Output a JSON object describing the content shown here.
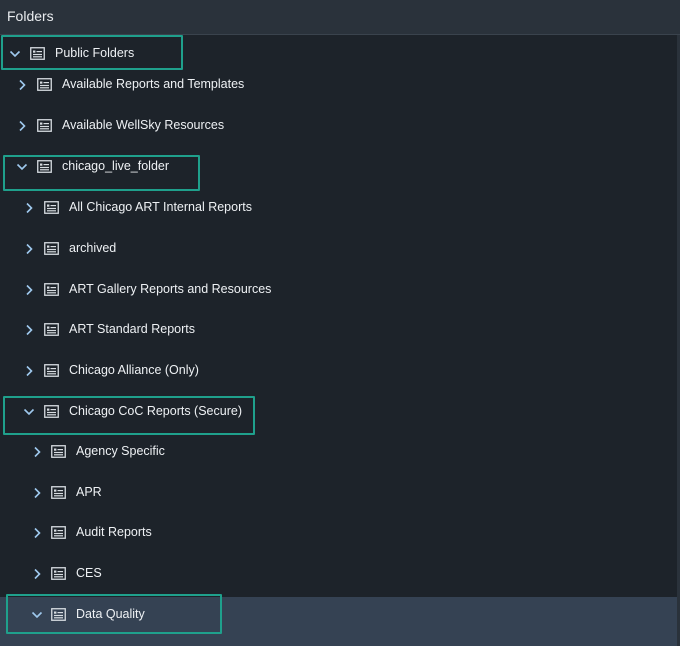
{
  "header": {
    "title": "Folders"
  },
  "tree": {
    "items": [
      {
        "label": "Public Folders",
        "expanded": true,
        "level": 0
      },
      {
        "label": "Available Reports and Templates",
        "expanded": false,
        "level": 1
      },
      {
        "label": "Available WellSky Resources",
        "expanded": false,
        "level": 1
      },
      {
        "label": "chicago_live_folder",
        "expanded": true,
        "level": 1
      },
      {
        "label": "All Chicago ART Internal Reports",
        "expanded": false,
        "level": 2
      },
      {
        "label": "archived",
        "expanded": false,
        "level": 2
      },
      {
        "label": "ART Gallery Reports and Resources",
        "expanded": false,
        "level": 2
      },
      {
        "label": "ART Standard Reports",
        "expanded": false,
        "level": 2
      },
      {
        "label": "Chicago Alliance (Only)",
        "expanded": false,
        "level": 2
      },
      {
        "label": "Chicago CoC Reports (Secure)",
        "expanded": true,
        "level": 2
      },
      {
        "label": "Agency Specific",
        "expanded": false,
        "level": 3
      },
      {
        "label": "APR",
        "expanded": false,
        "level": 3
      },
      {
        "label": "Audit Reports",
        "expanded": false,
        "level": 3
      },
      {
        "label": "CES",
        "expanded": false,
        "level": 3
      },
      {
        "label": "Data Quality",
        "expanded": true,
        "level": 3,
        "selected": true
      }
    ]
  },
  "colors": {
    "background": "#1d232a",
    "header": "#2a323b",
    "selected_row": "#354253",
    "highlight_border": "#1fa08c",
    "chevron": "#9fc9ee",
    "text": "#eef1f4"
  }
}
